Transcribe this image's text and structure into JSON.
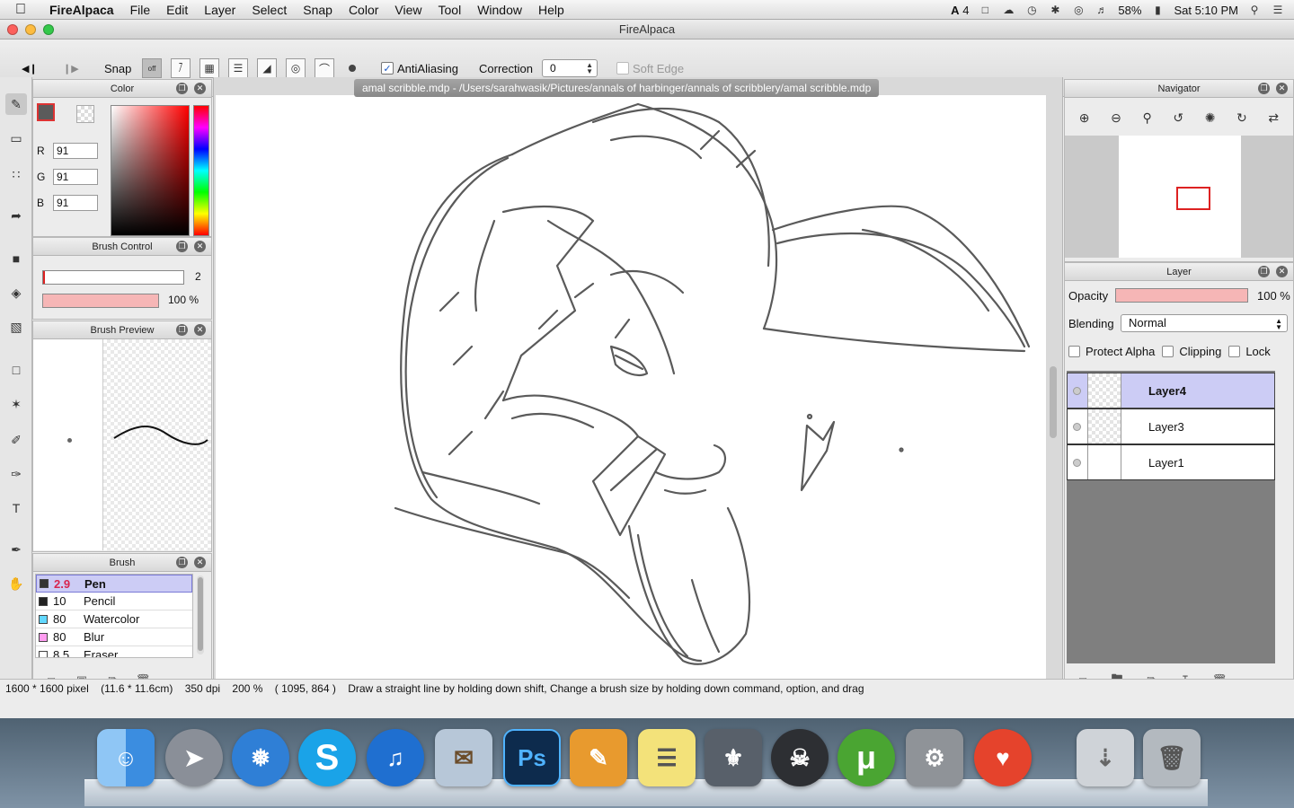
{
  "menubar": {
    "app_name": "FireAlpaca",
    "menus": [
      "File",
      "Edit",
      "Layer",
      "Select",
      "Snap",
      "Color",
      "View",
      "Tool",
      "Window",
      "Help"
    ],
    "tray": {
      "adobe_count": "4",
      "battery": "58%",
      "clock": "Sat 5:10 PM"
    }
  },
  "window": {
    "title": "FireAlpaca"
  },
  "toolbar": {
    "snap_label": "Snap",
    "snap_off_label": "off",
    "antialiasing_label": "AntiAliasing",
    "antialiasing_checked": true,
    "correction_label": "Correction",
    "correction_value": "0",
    "soft_edge_label": "Soft Edge",
    "soft_edge_checked": false
  },
  "color_panel": {
    "title": "Color",
    "r_label": "R",
    "r_value": "91",
    "g_label": "G",
    "g_value": "91",
    "b_label": "B",
    "b_value": "91",
    "fg_color": "#5b5b5b"
  },
  "brush_control": {
    "title": "Brush Control",
    "size_value": "2",
    "opacity_value": "100 %"
  },
  "brush_preview": {
    "title": "Brush Preview"
  },
  "brush_panel": {
    "title": "Brush",
    "items": [
      {
        "size": "2.9",
        "name": "Pen",
        "color": "#333333",
        "selected": true
      },
      {
        "size": "10",
        "name": "Pencil",
        "color": "#222222",
        "selected": false
      },
      {
        "size": "80",
        "name": "Watercolor",
        "color": "#62d8ff",
        "selected": false
      },
      {
        "size": "80",
        "name": "Blur",
        "color": "#ff9cf0",
        "selected": false
      },
      {
        "size": "8.5",
        "name": "Eraser",
        "color": "#ffffff",
        "selected": false
      }
    ]
  },
  "document": {
    "tab_title": "amal scribble.mdp - /Users/sarahwasik/Pictures/annals of harbinger/annals of scribblery/amal scribble.mdp"
  },
  "navigator": {
    "title": "Navigator"
  },
  "layer_panel": {
    "title": "Layer",
    "opacity_label": "Opacity",
    "opacity_value": "100 %",
    "blending_label": "Blending",
    "blending_value": "Normal",
    "protect_alpha_label": "Protect Alpha",
    "clipping_label": "Clipping",
    "lock_label": "Lock",
    "layers": [
      {
        "name": "Layer4",
        "selected": true
      },
      {
        "name": "Layer3",
        "selected": false
      },
      {
        "name": "Layer1",
        "selected": false
      }
    ]
  },
  "statusbar": {
    "canvas_size": "1600 * 1600 pixel",
    "physical_size": "(11.6 * 11.6cm)",
    "dpi": "350 dpi",
    "zoom": "200 %",
    "cursor": "( 1095, 864 )",
    "hint": "Draw a straight line by holding down shift, Change a brush size by holding down command, option, and drag"
  },
  "dock": {
    "items": [
      {
        "name": "Finder",
        "color": "#3b8de0"
      },
      {
        "name": "Launchpad",
        "color": "#8a8f98"
      },
      {
        "name": "Safari",
        "color": "#2f7fd6"
      },
      {
        "name": "Skype",
        "color": "#1aa3e8"
      },
      {
        "name": "iTunes",
        "color": "#1f6fd0"
      },
      {
        "name": "Mail",
        "color": "#b7c7d8"
      },
      {
        "name": "Photoshop",
        "color": "#0d2b4d",
        "glyph": "Ps"
      },
      {
        "name": "Pages",
        "color": "#e89a2e"
      },
      {
        "name": "Stickies",
        "color": "#f3e27a"
      },
      {
        "name": "Skyrim",
        "color": "#58606a"
      },
      {
        "name": "Dishonored",
        "color": "#2d2f33"
      },
      {
        "name": "uTorrent",
        "color": "#4aa532"
      },
      {
        "name": "System Preferences",
        "color": "#8f9398"
      },
      {
        "name": "FireAlpaca",
        "color": "#e5432c"
      },
      {
        "name": "Downloads",
        "color": "#cfd3d8"
      },
      {
        "name": "Trash",
        "color": "#b3b9bf"
      }
    ]
  }
}
